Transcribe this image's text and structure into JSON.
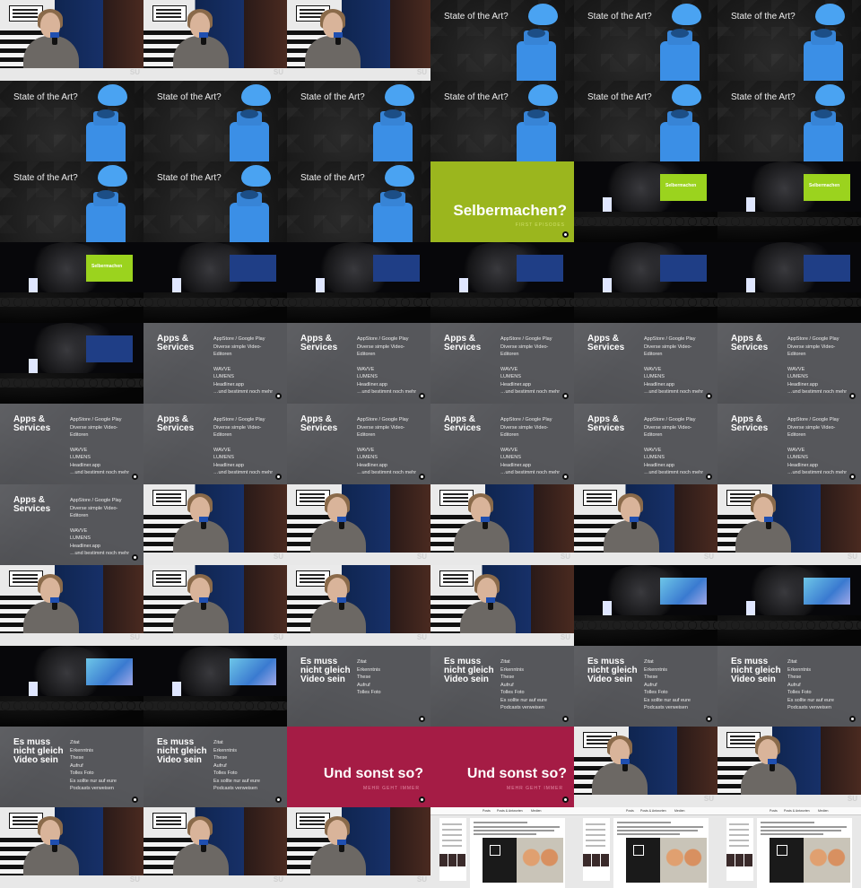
{
  "sota": {
    "title": "State of the Art?"
  },
  "selber": {
    "title": "Selbermachen?",
    "sub": "FIRST EPISODES"
  },
  "stage_screen": {
    "label": "Selbermachen"
  },
  "apps": {
    "title": "Apps &\nServices",
    "items": [
      "AppStore / Google Play",
      "Diverse simple Video-",
      "Editoren",
      "",
      "WAVVE",
      "LUMENS",
      "Headliner.app",
      "…und bestimmt noch mehr"
    ]
  },
  "video": {
    "title": "Es muss\nnicht gleich\nVideo sein",
    "items_short": [
      "Zitat",
      "Erkenntnis",
      "These",
      "Aufruf",
      "Tolles Foto"
    ],
    "items_full": [
      "Zitat",
      "Erkenntnis",
      "These",
      "Aufruf",
      "Tolles Foto",
      "Es sollte nur auf eure",
      "Podcasts verweisen"
    ]
  },
  "sonst": {
    "title": "Und sonst so?",
    "sub": "MEHR GEHT IMMER"
  },
  "web": {
    "nav": [
      "Posts",
      "Posts & Antworten",
      "Medien"
    ]
  },
  "brand_colors": {
    "green": "#9bb61e",
    "red": "#a51c45",
    "blue": "#4aa3f2",
    "gray": "#56575b"
  },
  "frames": [
    "speaker-1",
    "speaker-2",
    "speaker-3",
    "sota",
    "sota",
    "sota",
    "sota",
    "sota-flame",
    "sota",
    "sota",
    "sota",
    "sota",
    "sota",
    "sota",
    "sota",
    "selbermachen",
    "stage-green",
    "stage-green",
    "stage-green",
    "stage-blue",
    "stage-blue",
    "stage-blue",
    "stage-blue",
    "stage-blue",
    "stage-blue",
    "apps",
    "apps",
    "apps",
    "apps",
    "apps",
    "apps",
    "apps",
    "apps",
    "apps",
    "apps",
    "apps",
    "apps",
    "speaker-2",
    "speaker-1",
    "speaker-1",
    "speaker-2",
    "speaker-3",
    "speaker-1",
    "speaker-2",
    "speaker-1",
    "speaker-2",
    "stage-cyan",
    "stage-cyan",
    "stage-cyan",
    "stage-cyan",
    "video-short",
    "video-full",
    "video-full",
    "video-full",
    "video-full",
    "video-full",
    "sonst",
    "sonst",
    "speaker-3",
    "speaker-1",
    "speaker-1",
    "speaker-2",
    "speaker-1",
    "web",
    "web",
    "web"
  ]
}
